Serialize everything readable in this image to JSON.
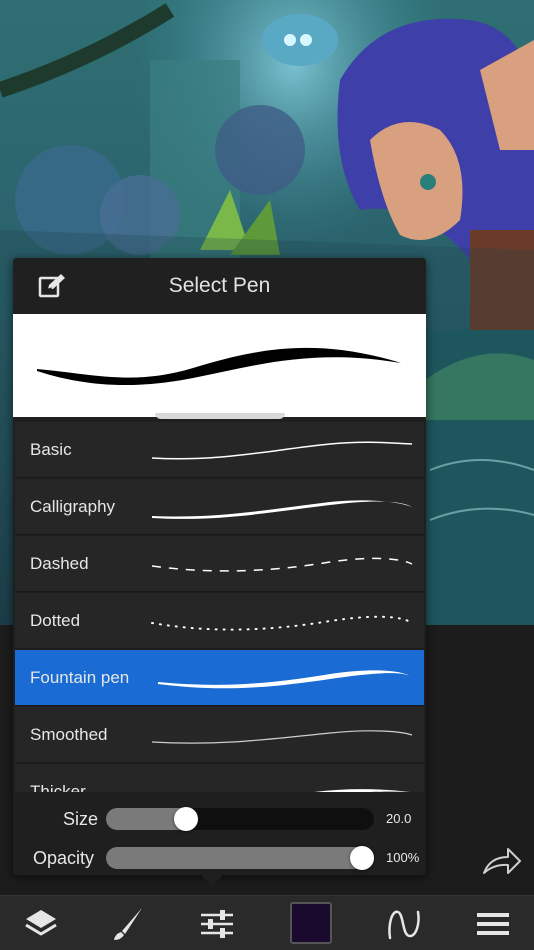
{
  "panel": {
    "title": "Select Pen",
    "edit_icon": "edit-icon"
  },
  "pens": [
    {
      "label": "Basic",
      "stroke": "basic"
    },
    {
      "label": "Calligraphy",
      "stroke": "calligraphy"
    },
    {
      "label": "Dashed",
      "stroke": "dashed"
    },
    {
      "label": "Dotted",
      "stroke": "dotted"
    },
    {
      "label": "Fountain pen",
      "stroke": "fountain",
      "selected": true
    },
    {
      "label": "Smoothed",
      "stroke": "smoothed"
    },
    {
      "label": "Thicker",
      "stroke": "thicker"
    }
  ],
  "sliders": {
    "size": {
      "label": "Size",
      "value_text": "20.0",
      "fraction": 0.28
    },
    "opacity": {
      "label": "Opacity",
      "value_text": "100%",
      "fraction": 1.0
    }
  },
  "toolbar": {
    "items": [
      "layers-icon",
      "brush-icon",
      "sliders-icon",
      "color-swatch",
      "pen-curve-icon",
      "menu-icon"
    ],
    "color": "#1a0a2e"
  },
  "colors": {
    "accent": "#1a6cd4",
    "panel": "#1f1f1f",
    "row": "#262626"
  },
  "redo_icon": "redo-icon"
}
